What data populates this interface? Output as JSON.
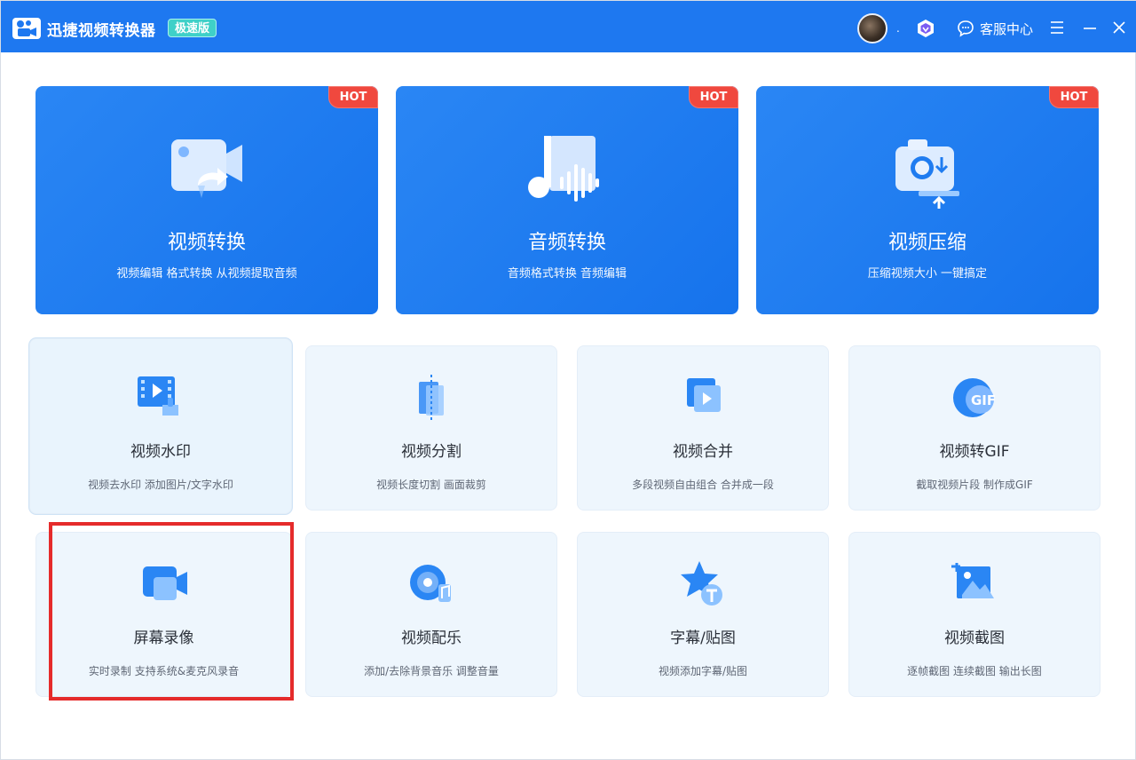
{
  "titlebar": {
    "app_title": "迅捷视频转换器",
    "edition_badge": "极速版",
    "dot": ".",
    "service_label": "客服中心"
  },
  "hot_cards": [
    {
      "title": "视频转换",
      "subtitle": "视频编辑 格式转换 从视频提取音频",
      "tag": "HOT",
      "icon": "video-convert-icon"
    },
    {
      "title": "音频转换",
      "subtitle": "音频格式转换 音频编辑",
      "tag": "HOT",
      "icon": "audio-convert-icon"
    },
    {
      "title": "视频压缩",
      "subtitle": "压缩视频大小 一键搞定",
      "tag": "HOT",
      "icon": "video-compress-icon"
    }
  ],
  "features": [
    {
      "title": "视频水印",
      "subtitle": "视频去水印 添加图片/文字水印",
      "icon": "watermark-icon"
    },
    {
      "title": "视频分割",
      "subtitle": "视频长度切割 画面裁剪",
      "icon": "split-icon"
    },
    {
      "title": "视频合并",
      "subtitle": "多段视频自由组合 合并成一段",
      "icon": "merge-icon"
    },
    {
      "title": "视频转GIF",
      "subtitle": "截取视频片段 制作成GIF",
      "icon": "gif-icon"
    },
    {
      "title": "屏幕录像",
      "subtitle": "实时录制 支持系统&麦克风录音",
      "icon": "screen-record-icon"
    },
    {
      "title": "视频配乐",
      "subtitle": "添加/去除背景音乐 调整音量",
      "icon": "music-icon"
    },
    {
      "title": "字幕/贴图",
      "subtitle": "视频添加字幕/贴图",
      "icon": "subtitle-sticker-icon"
    },
    {
      "title": "视频截图",
      "subtitle": "逐帧截图 连续截图 输出长图",
      "icon": "screenshot-icon"
    }
  ],
  "colors": {
    "titlebar": "#1e78f0",
    "hot_card": "#1f7cf0",
    "hot_tag": "#f0483e",
    "feature_card": "#eef6fd",
    "highlight": "#e52b2b"
  }
}
